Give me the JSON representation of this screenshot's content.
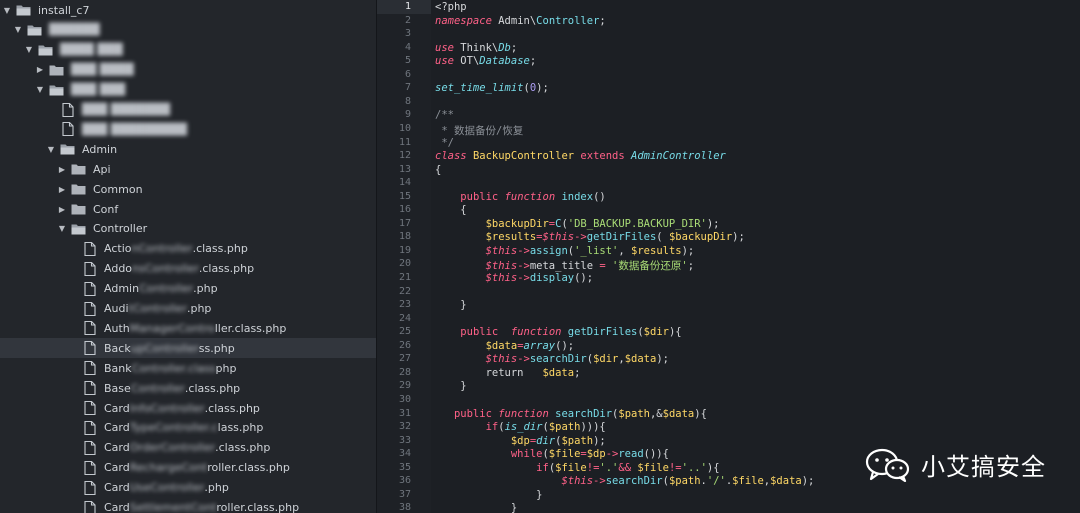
{
  "sidebar": {
    "items": [
      {
        "label": "install_c7",
        "type": "folder",
        "expanded": true,
        "depth": 0,
        "blurred": false,
        "icon": "folder-open-icon"
      },
      {
        "label": "██████",
        "type": "folder",
        "expanded": true,
        "depth": 1,
        "blurred": true,
        "icon": "folder-open-icon"
      },
      {
        "label": "████ ███",
        "type": "folder",
        "expanded": true,
        "depth": 2,
        "blurred": true,
        "icon": "folder-open-icon"
      },
      {
        "label": "███ ████",
        "type": "folder",
        "expanded": false,
        "depth": 3,
        "blurred": true,
        "icon": "folder-icon"
      },
      {
        "label": "███ ███",
        "type": "folder",
        "expanded": true,
        "depth": 3,
        "blurred": true,
        "icon": "folder-open-icon"
      },
      {
        "label": "███ ███████",
        "type": "file",
        "depth": 4,
        "blurred": true,
        "icon": "file-icon"
      },
      {
        "label": "███ █████████",
        "type": "file",
        "depth": 4,
        "blurred": true,
        "icon": "file-icon"
      },
      {
        "label": "Admin",
        "type": "folder",
        "expanded": true,
        "depth": 4,
        "blurred": false,
        "icon": "folder-open-icon"
      },
      {
        "label": "Api",
        "type": "folder",
        "expanded": false,
        "depth": 5,
        "blurred": false,
        "icon": "folder-icon"
      },
      {
        "label": "Common",
        "type": "folder",
        "expanded": false,
        "depth": 5,
        "blurred": false,
        "icon": "folder-icon"
      },
      {
        "label": "Conf",
        "type": "folder",
        "expanded": false,
        "depth": 5,
        "blurred": false,
        "icon": "folder-icon"
      },
      {
        "label": "Controller",
        "type": "folder",
        "expanded": true,
        "depth": 5,
        "blurred": false,
        "icon": "folder-open-icon"
      },
      {
        "label_visible": "Actio",
        "label_hidden": "nController",
        "label_tail": ".class.php",
        "type": "file",
        "depth": 6,
        "icon": "file-icon"
      },
      {
        "label_visible": "Addo",
        "label_hidden": "nsController",
        "label_tail": ".class.php",
        "type": "file",
        "depth": 6,
        "icon": "file-icon"
      },
      {
        "label_visible": "Admin",
        "label_hidden": "Controller",
        "label_tail": ".php",
        "type": "file",
        "depth": 6,
        "icon": "file-icon"
      },
      {
        "label_visible": "Audi",
        "label_hidden": "tController",
        "label_tail": ".php",
        "type": "file",
        "depth": 6,
        "icon": "file-icon"
      },
      {
        "label_visible": "Auth",
        "label_hidden": "ManagerContro",
        "label_tail": "ller.class.php",
        "type": "file",
        "depth": 6,
        "icon": "file-icon"
      },
      {
        "label_visible": "Back",
        "label_hidden": "upController",
        "label_tail": "ss.php",
        "type": "file",
        "depth": 6,
        "icon": "file-icon",
        "selected": true
      },
      {
        "label_visible": "Bank",
        "label_hidden": "Controller.class",
        "label_tail": "php",
        "type": "file",
        "depth": 6,
        "icon": "file-icon"
      },
      {
        "label_visible": "Base",
        "label_hidden": "Controller",
        "label_tail": ".class.php",
        "type": "file",
        "depth": 6,
        "icon": "file-icon"
      },
      {
        "label_visible": "Card",
        "label_hidden": "InfoController",
        "label_tail": ".class.php",
        "type": "file",
        "depth": 6,
        "icon": "file-icon"
      },
      {
        "label_visible": "Card",
        "label_hidden": "TypeController.c",
        "label_tail": "lass.php",
        "type": "file",
        "depth": 6,
        "icon": "file-icon"
      },
      {
        "label_visible": "Card",
        "label_hidden": "OrderController",
        "label_tail": ".class.php",
        "type": "file",
        "depth": 6,
        "icon": "file-icon"
      },
      {
        "label_visible": "Card",
        "label_hidden": "RechargeCont",
        "label_tail": "roller.class.php",
        "type": "file",
        "depth": 6,
        "icon": "file-icon"
      },
      {
        "label_visible": "Card",
        "label_hidden": "UseController",
        "label_tail": ".php",
        "type": "file",
        "depth": 6,
        "icon": "file-icon"
      },
      {
        "label_visible": "Card",
        "label_hidden": "SettlementCont",
        "label_tail": "roller.class.php",
        "type": "file",
        "depth": 6,
        "icon": "file-icon"
      }
    ]
  },
  "editor": {
    "current_line": 1,
    "lines": [
      {
        "n": "1",
        "t": [
          [
            "plain",
            "<?php"
          ]
        ]
      },
      {
        "n": "2",
        "t": [
          [
            "kwi",
            "namespace"
          ],
          [
            "plain",
            " Admin\\"
          ],
          [
            "fn",
            "Controller"
          ],
          [
            "plain",
            ";"
          ]
        ]
      },
      {
        "n": "3",
        "t": []
      },
      {
        "n": "4",
        "t": [
          [
            "kwi",
            "use"
          ],
          [
            "plain",
            " Think\\"
          ],
          [
            "cls",
            "Db"
          ],
          [
            "plain",
            ";"
          ]
        ]
      },
      {
        "n": "5",
        "t": [
          [
            "kwi",
            "use"
          ],
          [
            "plain",
            " OT\\"
          ],
          [
            "cls",
            "Database"
          ],
          [
            "plain",
            ";"
          ]
        ]
      },
      {
        "n": "6",
        "t": []
      },
      {
        "n": "7",
        "t": [
          [
            "cls",
            "set_time_limit"
          ],
          [
            "plain",
            "("
          ],
          [
            "num",
            "0"
          ],
          [
            "plain",
            ");"
          ]
        ]
      },
      {
        "n": "8",
        "t": []
      },
      {
        "n": "9",
        "t": [
          [
            "cmt",
            "/**"
          ]
        ]
      },
      {
        "n": "10",
        "t": [
          [
            "cmt",
            " * 数据备份/恢复"
          ]
        ]
      },
      {
        "n": "11",
        "t": [
          [
            "cmt",
            " */"
          ]
        ]
      },
      {
        "n": "12",
        "t": [
          [
            "kwi",
            "class"
          ],
          [
            "plain",
            " "
          ],
          [
            "var",
            "BackupController"
          ],
          [
            "plain",
            " "
          ],
          [
            "kw",
            "extends"
          ],
          [
            "plain",
            " "
          ],
          [
            "cls",
            "AdminController"
          ]
        ]
      },
      {
        "n": "13",
        "t": [
          [
            "plain",
            "{"
          ]
        ]
      },
      {
        "n": "14",
        "t": []
      },
      {
        "n": "15",
        "t": [
          [
            "plain",
            "    "
          ],
          [
            "kw",
            "public"
          ],
          [
            "plain",
            " "
          ],
          [
            "kwi",
            "function"
          ],
          [
            "plain",
            " "
          ],
          [
            "fn",
            "index"
          ],
          [
            "plain",
            "()"
          ]
        ]
      },
      {
        "n": "16",
        "t": [
          [
            "plain",
            "    {"
          ]
        ]
      },
      {
        "n": "17",
        "t": [
          [
            "plain",
            "        "
          ],
          [
            "var",
            "$backupDir"
          ],
          [
            "kw",
            "="
          ],
          [
            "fn",
            "C"
          ],
          [
            "plain",
            "("
          ],
          [
            "str",
            "'DB_BACKUP.BACKUP_DIR'"
          ],
          [
            "plain",
            ");"
          ]
        ]
      },
      {
        "n": "18",
        "t": [
          [
            "plain",
            "        "
          ],
          [
            "var",
            "$results"
          ],
          [
            "kw",
            "="
          ],
          [
            "thisv",
            "$this"
          ],
          [
            "kw",
            "->"
          ],
          [
            "fn",
            "getDirFiles"
          ],
          [
            "plain",
            "( "
          ],
          [
            "var",
            "$backupDir"
          ],
          [
            "plain",
            ");"
          ]
        ]
      },
      {
        "n": "19",
        "t": [
          [
            "plain",
            "        "
          ],
          [
            "thisv",
            "$this"
          ],
          [
            "kw",
            "->"
          ],
          [
            "fn",
            "assign"
          ],
          [
            "plain",
            "("
          ],
          [
            "str",
            "'_list'"
          ],
          [
            "plain",
            ", "
          ],
          [
            "var",
            "$results"
          ],
          [
            "plain",
            ");"
          ]
        ]
      },
      {
        "n": "20",
        "t": [
          [
            "plain",
            "        "
          ],
          [
            "thisv",
            "$this"
          ],
          [
            "kw",
            "->"
          ],
          [
            "plain",
            "meta_title "
          ],
          [
            "kw",
            "="
          ],
          [
            "plain",
            " "
          ],
          [
            "str",
            "'数据备份还原'"
          ],
          [
            "plain",
            ";"
          ]
        ]
      },
      {
        "n": "21",
        "t": [
          [
            "plain",
            "        "
          ],
          [
            "thisv",
            "$this"
          ],
          [
            "kw",
            "->"
          ],
          [
            "fn",
            "display"
          ],
          [
            "plain",
            "();"
          ]
        ]
      },
      {
        "n": "22",
        "t": []
      },
      {
        "n": "23",
        "t": [
          [
            "plain",
            "    }"
          ]
        ]
      },
      {
        "n": "24",
        "t": []
      },
      {
        "n": "25",
        "t": [
          [
            "plain",
            "    "
          ],
          [
            "kw",
            "public"
          ],
          [
            "plain",
            "  "
          ],
          [
            "kwi",
            "function"
          ],
          [
            "plain",
            " "
          ],
          [
            "fn",
            "getDirFiles"
          ],
          [
            "plain",
            "("
          ],
          [
            "var",
            "$dir"
          ],
          [
            "plain",
            "){"
          ]
        ]
      },
      {
        "n": "26",
        "t": [
          [
            "plain",
            "        "
          ],
          [
            "var",
            "$data"
          ],
          [
            "kw",
            "="
          ],
          [
            "cls",
            "array"
          ],
          [
            "plain",
            "();"
          ]
        ]
      },
      {
        "n": "27",
        "t": [
          [
            "plain",
            "        "
          ],
          [
            "thisv",
            "$this"
          ],
          [
            "kw",
            "->"
          ],
          [
            "fn",
            "searchDir"
          ],
          [
            "plain",
            "("
          ],
          [
            "var",
            "$dir"
          ],
          [
            "plain",
            ","
          ],
          [
            "var",
            "$data"
          ],
          [
            "plain",
            ");"
          ]
        ]
      },
      {
        "n": "28",
        "t": [
          [
            "plain",
            "        return   "
          ],
          [
            "var",
            "$data"
          ],
          [
            "plain",
            ";"
          ]
        ]
      },
      {
        "n": "29",
        "t": [
          [
            "plain",
            "    }"
          ]
        ]
      },
      {
        "n": "30",
        "t": []
      },
      {
        "n": "31",
        "t": [
          [
            "plain",
            "   "
          ],
          [
            "kw",
            "public"
          ],
          [
            "plain",
            " "
          ],
          [
            "kwi",
            "function"
          ],
          [
            "plain",
            " "
          ],
          [
            "fn",
            "searchDir"
          ],
          [
            "plain",
            "("
          ],
          [
            "var",
            "$path"
          ],
          [
            "plain",
            ",&"
          ],
          [
            "var",
            "$data"
          ],
          [
            "plain",
            "){"
          ]
        ]
      },
      {
        "n": "32",
        "t": [
          [
            "plain",
            "        "
          ],
          [
            "kw",
            "if"
          ],
          [
            "plain",
            "("
          ],
          [
            "cls",
            "is_dir"
          ],
          [
            "plain",
            "("
          ],
          [
            "var",
            "$path"
          ],
          [
            "plain",
            "))){"
          ]
        ]
      },
      {
        "n": "33",
        "t": [
          [
            "plain",
            "            "
          ],
          [
            "var",
            "$dp"
          ],
          [
            "kw",
            "="
          ],
          [
            "cls",
            "dir"
          ],
          [
            "plain",
            "("
          ],
          [
            "var",
            "$path"
          ],
          [
            "plain",
            ");"
          ]
        ]
      },
      {
        "n": "34",
        "t": [
          [
            "plain",
            "            "
          ],
          [
            "kw",
            "while"
          ],
          [
            "plain",
            "("
          ],
          [
            "var",
            "$file"
          ],
          [
            "kw",
            "="
          ],
          [
            "var",
            "$dp"
          ],
          [
            "kw",
            "->"
          ],
          [
            "fn",
            "read"
          ],
          [
            "plain",
            "()){"
          ]
        ]
      },
      {
        "n": "35",
        "t": [
          [
            "plain",
            "                "
          ],
          [
            "kw",
            "if"
          ],
          [
            "plain",
            "("
          ],
          [
            "var",
            "$file"
          ],
          [
            "kw",
            "!="
          ],
          [
            "str",
            "'.'"
          ],
          [
            "kw",
            "&&"
          ],
          [
            "plain",
            " "
          ],
          [
            "var",
            "$file"
          ],
          [
            "kw",
            "!="
          ],
          [
            "str",
            "'..'"
          ],
          [
            "plain",
            "){"
          ]
        ]
      },
      {
        "n": "36",
        "t": [
          [
            "plain",
            "                    "
          ],
          [
            "thisv",
            "$this"
          ],
          [
            "kw",
            "->"
          ],
          [
            "fn",
            "searchDir"
          ],
          [
            "plain",
            "("
          ],
          [
            "var",
            "$path"
          ],
          [
            "plain",
            "."
          ],
          [
            "str",
            "'/'"
          ],
          [
            "plain",
            "."
          ],
          [
            "var",
            "$file"
          ],
          [
            "plain",
            ","
          ],
          [
            "var",
            "$data"
          ],
          [
            "plain",
            ");"
          ]
        ]
      },
      {
        "n": "37",
        "t": [
          [
            "plain",
            "                }"
          ]
        ]
      },
      {
        "n": "38",
        "t": [
          [
            "plain",
            "            }"
          ]
        ]
      }
    ]
  },
  "watermark": {
    "text": "小艾搞安全",
    "icon": "wechat-icon"
  }
}
